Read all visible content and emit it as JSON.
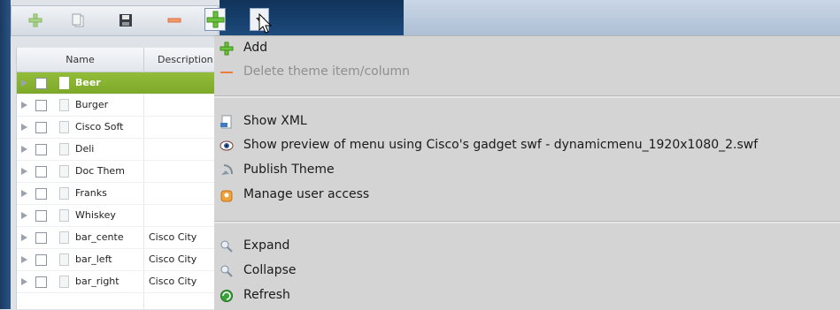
{
  "toolbar": {
    "buttons": [
      {
        "icon": "add-icon"
      },
      {
        "icon": "copy-icon"
      },
      {
        "icon": "save-icon"
      },
      {
        "icon": "delete-icon"
      },
      {
        "icon": "add-icon"
      },
      {
        "icon": "dropdown-arrow-icon"
      }
    ]
  },
  "grid": {
    "columns": {
      "name": "Name",
      "description": "Description"
    },
    "rows": [
      {
        "name": "Beer",
        "description": "",
        "selected": true
      },
      {
        "name": "Burger",
        "description": ""
      },
      {
        "name": "Cisco Soft",
        "description": ""
      },
      {
        "name": "Deli",
        "description": ""
      },
      {
        "name": "Doc Them",
        "description": ""
      },
      {
        "name": "Franks",
        "description": ""
      },
      {
        "name": "Whiskey",
        "description": ""
      },
      {
        "name": "bar_cente",
        "description": "Cisco City"
      },
      {
        "name": "bar_left",
        "description": "Cisco City"
      },
      {
        "name": "bar_right",
        "description": "Cisco City"
      }
    ]
  },
  "menu": {
    "add": "Add",
    "delete_item": "Delete theme item/column",
    "show_xml": "Show XML",
    "show_preview": "Show preview of menu using Cisco's gadget swf - dynamicmenu_1920x1080_2.swf",
    "publish": "Publish Theme",
    "manage_access": "Manage user access",
    "expand": "Expand",
    "collapse": "Collapse",
    "refresh": "Refresh"
  },
  "colors": {
    "selected_row": "#8cb832",
    "menu_bg": "#d4d4d4",
    "add_green": "#5cb82e",
    "delete_orange": "#f07a3a"
  }
}
